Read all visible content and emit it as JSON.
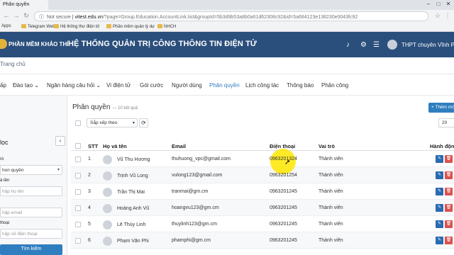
{
  "browser": {
    "tab_title": "Phân quyền",
    "controls": [
      "–",
      "□",
      "✕"
    ],
    "security": "Not secure",
    "url_host": "vitest.edu.vn",
    "url_path": "/?page=Group.Education.AccountLink.list&groupId=5b3d9b53a8b0a61d62308c92&id=5a684123e138230e0043fc92",
    "bookmarks": [
      "Apps",
      "Telegram Web",
      "Hệ thống thư điện tử",
      "Phần mềm quản lý dự",
      "NHCH"
    ]
  },
  "header": {
    "app_name": "PHẦN MỀM KHẢO THÍ",
    "system_title": "HỆ THỐNG QUẢN TRỊ CÔNG THÔNG TIN ĐIỆN TỬ",
    "user": "THPT chuyên Vĩnh Ph",
    "icons": [
      "bell-icon",
      "gear-icon",
      "menu-icon",
      "avatar"
    ]
  },
  "breadcrumb": "Trang chủ",
  "menu": [
    {
      "label": "ấp",
      "active": false
    },
    {
      "label": "Đào tạo ⌄",
      "active": false
    },
    {
      "label": "Ngân hàng câu hỏi ⌄",
      "active": false
    },
    {
      "label": "Vi điện tử",
      "active": false
    },
    {
      "label": "Gói cước",
      "active": false
    },
    {
      "label": "Người dùng",
      "active": false
    },
    {
      "label": "Phân quyền",
      "active": true
    },
    {
      "label": "Lịch công tác",
      "active": false
    },
    {
      "label": "Thông báo",
      "active": false
    },
    {
      "label": "Phân công",
      "active": false
    }
  ],
  "sidebar": {
    "title": "lọc",
    "collapse_symbol": "‹",
    "fields": [
      {
        "label": "rò",
        "value": "hon quyền",
        "selected": true
      },
      {
        "label": "à tên",
        "value": "hập họ tên",
        "selected": false
      },
      {
        "label": "",
        "value": "hập email",
        "selected": false
      },
      {
        "label": "thoại",
        "value": "hập số điện thoại",
        "selected": false
      }
    ],
    "search_button": "Tìm kiếm"
  },
  "main": {
    "title": "Phân quyền",
    "count": "— 10 kết quả",
    "add_button": "+ Thêm mớ",
    "sort_label": "Sắp xếp theo",
    "page_size": "20",
    "columns": [
      "STT",
      "Họ và tên",
      "Email",
      "Điện thoại",
      "Vai trò",
      "Hành độn"
    ],
    "rows": [
      {
        "stt": "1",
        "name": "Vũ Thu Hương",
        "email": "thuhuong_vpc@gmail.com",
        "phone": "0963201324",
        "role": "Thành viên"
      },
      {
        "stt": "2",
        "name": "Trịnh Vũ Long",
        "email": "vulong123@gmail.com",
        "phone": "0963201254",
        "role": "Thành viên"
      },
      {
        "stt": "3",
        "name": "Trần Thị Mai",
        "email": "tranmai@gm.cm",
        "phone": "0963201245",
        "role": "Thành viên"
      },
      {
        "stt": "4",
        "name": "Hoàng Anh Vũ",
        "email": "hoangvu123@gm.cm",
        "phone": "0963201245",
        "role": "Thành viên"
      },
      {
        "stt": "5",
        "name": "Lê Thùy Linh",
        "email": "thuylinh123@gm.cm",
        "phone": "0963201245",
        "role": "Thành viên"
      },
      {
        "stt": "6",
        "name": "Phạm Văn Phi",
        "email": "phamphi@gm.cm",
        "phone": "0963201245",
        "role": "Thành viên"
      }
    ]
  },
  "colors": {
    "header_bg": "#2b4f7c",
    "accent": "#2f7ebf",
    "delete": "#d9534f",
    "cursor_highlight": "#ffe600"
  }
}
